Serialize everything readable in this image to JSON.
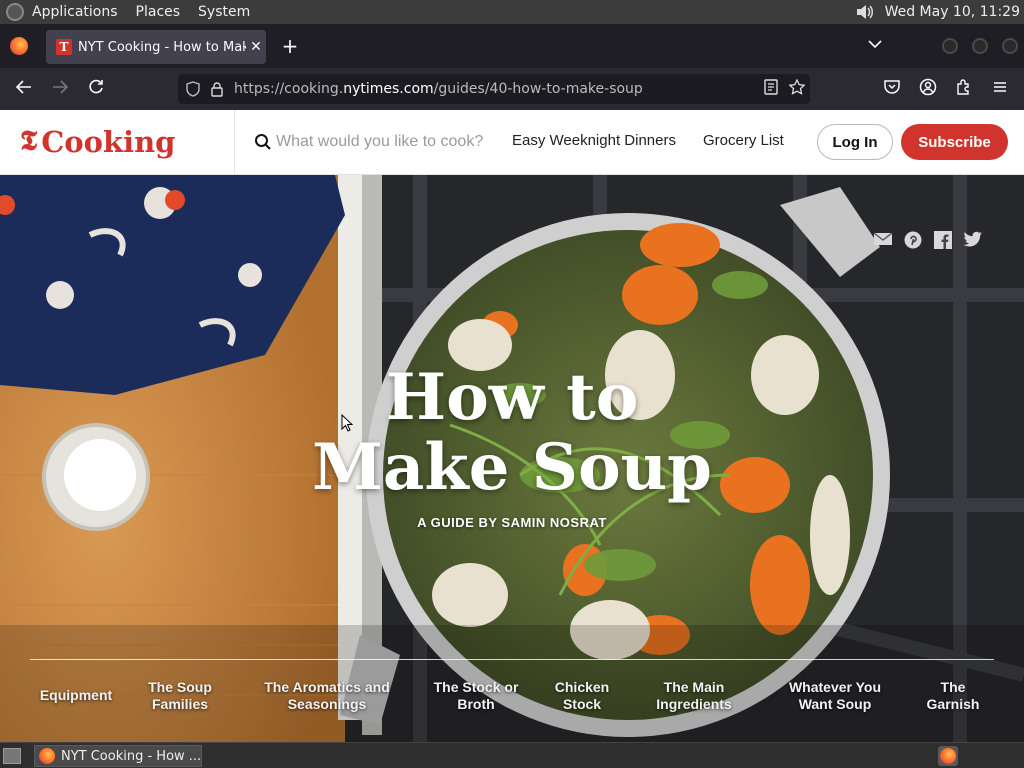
{
  "system_panel": {
    "menus": [
      "Applications",
      "Places",
      "System"
    ],
    "clock": "Wed May 10, 11:29"
  },
  "browser": {
    "tab": {
      "title": "NYT Cooking - How to Make Soup",
      "favicon_letter": "T"
    },
    "new_tab_label": "+",
    "url": {
      "prefix": "https://cooking.",
      "domain": "nytimes.com",
      "path": "/guides/40-how-to-make-soup"
    }
  },
  "site": {
    "brand": {
      "logo_letter": "𝕿",
      "name": "Cooking",
      "color": "#d0342c"
    },
    "search": {
      "placeholder": "What would you like to cook?"
    },
    "nav": {
      "easy_weeknight": "Easy Weeknight Dinners",
      "grocery_list": "Grocery List"
    },
    "login_label": "Log In",
    "subscribe_label": "Subscribe"
  },
  "hero": {
    "title_line1": "How to",
    "title_line2": "Make Soup",
    "subtitle": "A GUIDE BY SAMIN NOSRAT",
    "share_icons": [
      "email-icon",
      "pinterest-icon",
      "facebook-icon",
      "twitter-icon"
    ],
    "guide_nav": [
      {
        "line1": "Equipment",
        "line2": ""
      },
      {
        "line1": "The Soup",
        "line2": "Families"
      },
      {
        "line1": "The Aromatics and",
        "line2": "Seasonings"
      },
      {
        "line1": "The Stock or",
        "line2": "Broth"
      },
      {
        "line1": "Chicken",
        "line2": "Stock"
      },
      {
        "line1": "The Main",
        "line2": "Ingredients"
      },
      {
        "line1": "Whatever You",
        "line2": "Want Soup"
      },
      {
        "line1": "The",
        "line2": "Garnish"
      }
    ]
  },
  "taskbar": {
    "window_label": "NYT Cooking - How ..."
  }
}
